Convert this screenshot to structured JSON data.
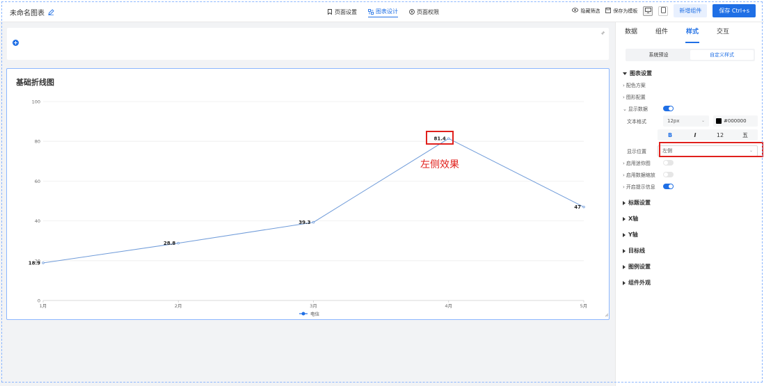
{
  "header": {
    "title": "未命名图表",
    "nav": [
      {
        "label": "页面设置",
        "icon": "bookmark-icon",
        "active": false
      },
      {
        "label": "图表设计",
        "icon": "chart-icon",
        "active": true
      },
      {
        "label": "页面权限",
        "icon": "permission-icon",
        "active": false
      }
    ],
    "hide_filter": "隐藏筛选",
    "save_template": "保存为模板",
    "add_component": "新增组件",
    "save": "保存 Ctrl+s"
  },
  "colors": {
    "primary": "#1f6fe5",
    "annotation": "#e0201c",
    "line": "#6f9bd9"
  },
  "chart_card": {
    "title": "基础折线图"
  },
  "chart_data": {
    "type": "line",
    "title": "基础折线图",
    "categories": [
      "1月",
      "2月",
      "3月",
      "4月",
      "5月"
    ],
    "series": [
      {
        "name": "电信",
        "values": [
          18.9,
          28.8,
          39.3,
          81.4,
          47
        ]
      }
    ],
    "ylim": [
      0,
      100
    ],
    "yticks": [
      0,
      20,
      40,
      60,
      80,
      100
    ],
    "data_labels": [
      "18.9",
      "28.8",
      "39.3",
      "81.4",
      "47"
    ],
    "label_position": "left",
    "grid": true,
    "legend": "bottom-center"
  },
  "annotation": {
    "text": "左侧效果"
  },
  "right_panel": {
    "tabs": [
      "数据",
      "组件",
      "样式",
      "交互"
    ],
    "active_tab": "样式",
    "segments": [
      "系统预设",
      "自定义样式"
    ],
    "chart_settings": "图表设置",
    "color_scheme": "配色方案",
    "shape_config": "图形配置",
    "show_data": "显示数据",
    "text_format": "文本格式",
    "font_size": "12px",
    "font_color": "#000000",
    "fmt_bold": "B",
    "fmt_italic": "I",
    "fmt_size": "12",
    "fmt_extra": "五",
    "display_position": "显示位置",
    "position_value": "左侧",
    "enable_mini_map": "启用迷你图",
    "enable_zoom": "启用数据缩放",
    "enable_tooltip": "开启提示信息",
    "sections": [
      "标题设置",
      "X轴",
      "Y轴",
      "目标线",
      "图例设置",
      "组件外观"
    ]
  }
}
